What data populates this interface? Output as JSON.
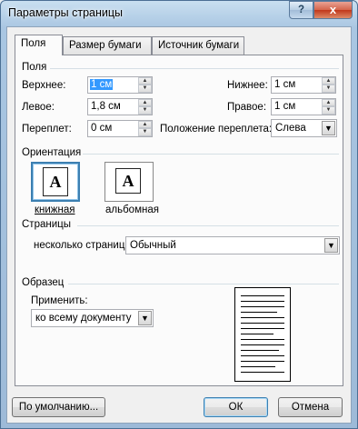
{
  "window": {
    "title": "Параметры страницы",
    "help_label": "?",
    "close_label": "x"
  },
  "tabs": [
    {
      "label": "Поля",
      "active": true
    },
    {
      "label": "Размер бумаги",
      "active": false
    },
    {
      "label": "Источник бумаги",
      "active": false
    }
  ],
  "margins": {
    "group_label": "Поля",
    "top": {
      "label": "Верхнее:",
      "value": "1 см"
    },
    "bottom": {
      "label": "Нижнее:",
      "value": "1 см"
    },
    "left": {
      "label": "Левое:",
      "value": "1,8 см"
    },
    "right": {
      "label": "Правое:",
      "value": "1 см"
    },
    "gutter": {
      "label": "Переплет:",
      "value": "0 см"
    },
    "gutter_pos": {
      "label": "Положение переплета:",
      "value": "Слева"
    }
  },
  "orientation": {
    "group_label": "Ориентация",
    "portrait": {
      "label": "книжная",
      "glyph": "A",
      "selected": true
    },
    "landscape": {
      "label": "альбомная",
      "glyph": "A",
      "selected": false
    }
  },
  "pages": {
    "group_label": "Страницы",
    "multiple_label": "несколько страниц:",
    "multiple_value": "Обычный"
  },
  "sample": {
    "group_label": "Образец",
    "apply_label": "Применить:",
    "apply_value": "ко всему документу"
  },
  "buttons": {
    "default_label": "По умолчанию...",
    "ok_label": "ОК",
    "cancel_label": "Отмена"
  },
  "icons": {
    "dropdown": "▼",
    "spin_up": "▲",
    "spin_down": "▼"
  }
}
